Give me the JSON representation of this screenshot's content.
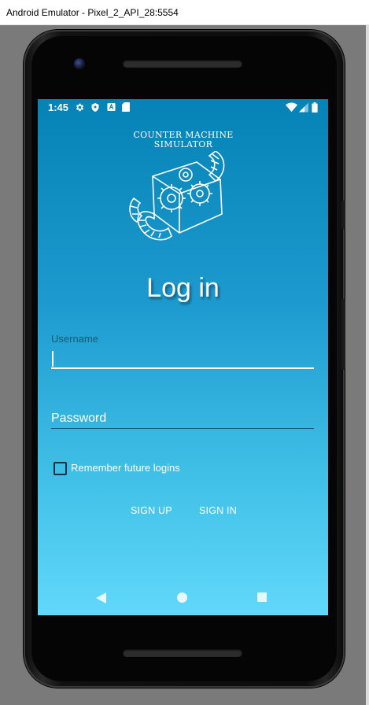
{
  "window": {
    "title": "Android Emulator - Pixel_2_API_28:5554"
  },
  "status_bar": {
    "time": "1:45",
    "left_icons": [
      "gear-icon",
      "shield-icon",
      "a-notification-icon",
      "sd-card-icon"
    ],
    "right_icons": [
      "wifi-icon",
      "signal-icon",
      "battery-icon"
    ]
  },
  "app": {
    "logo_line1": "Counter Machine",
    "logo_line2": "Simulator",
    "page_title": "Log in",
    "username": {
      "label": "Username",
      "value": ""
    },
    "password": {
      "placeholder": "Password",
      "value": ""
    },
    "remember": {
      "label": "Remember future logins",
      "checked": false
    },
    "buttons": {
      "sign_up": "SIGN UP",
      "sign_in": "SIGN IN"
    }
  },
  "navigation": {
    "icons": [
      "back-icon",
      "home-icon",
      "recents-icon"
    ]
  },
  "colors": {
    "screen_top": "#0583b6",
    "screen_bottom": "#61d8fb",
    "label": "#175a73",
    "text": "#ffffff"
  }
}
